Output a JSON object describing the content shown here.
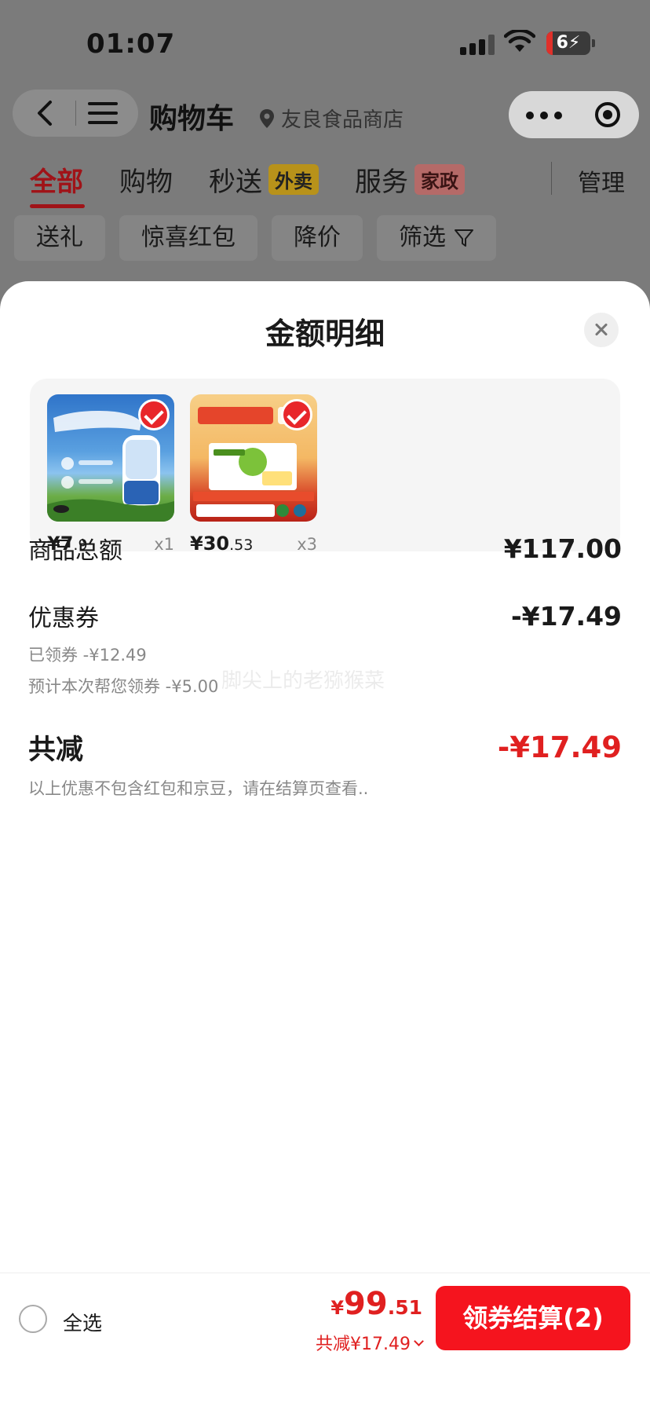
{
  "status_bar": {
    "time": "01:07",
    "battery": "6"
  },
  "header": {
    "title": "购物车",
    "location": "友良食品商店"
  },
  "tabs": [
    {
      "label": "全部",
      "tag": ""
    },
    {
      "label": "购物",
      "tag": ""
    },
    {
      "label": "秒送",
      "tag": "外卖"
    },
    {
      "label": "服务",
      "tag": "家政"
    }
  ],
  "manage_label": "管理",
  "filters": [
    "送礼",
    "惊喜红包",
    "降价",
    "筛选"
  ],
  "sheet": {
    "title": "金额明细",
    "products": [
      {
        "price_int": "¥7",
        "price_dec": ".9",
        "qty": "x1"
      },
      {
        "price_int": "¥30",
        "price_dec": ".53",
        "qty": "x3"
      }
    ],
    "goods_total_label": "商品总额",
    "goods_total_value": "¥117.00",
    "coupon_label": "优惠券",
    "coupon_value": "-¥17.49",
    "coupon_claimed": "已领券 -¥12.49",
    "coupon_estimate": "预计本次帮您领券 -¥5.00",
    "reduce_label": "共减",
    "reduce_value": "-¥17.49",
    "note": "以上优惠不包含红包和京豆，请在结算页查看..",
    "watermark": "脚尖上的老猕猴菜"
  },
  "bottom_bar": {
    "select_all": "全选",
    "total_yen": "¥",
    "total_int": "99",
    "total_dec": ".51",
    "saved": "共减¥17.49",
    "checkout": "领券结算(2)"
  }
}
